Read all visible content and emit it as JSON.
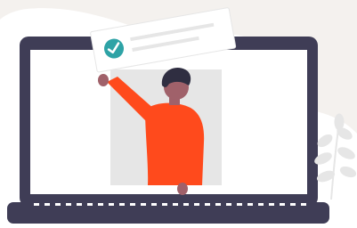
{
  "illustration": {
    "subject": "laptop-with-person-holding-checklist-card",
    "colors": {
      "background_blob": "#F4F1EE",
      "laptop_frame": "#3F3D56",
      "screen": "#FFFFFF",
      "photo_panel": "#E6E6E6",
      "shirt": "#FF4A1C",
      "skin": "#A0616A",
      "hair": "#2F2E41",
      "card": "#FFFFFF",
      "card_lines": "#E6E6E6",
      "check_badge": "#2EA3A6",
      "plant": "#E6E6E6"
    },
    "icons": [
      "check-circle-icon",
      "plant-icon"
    ]
  }
}
